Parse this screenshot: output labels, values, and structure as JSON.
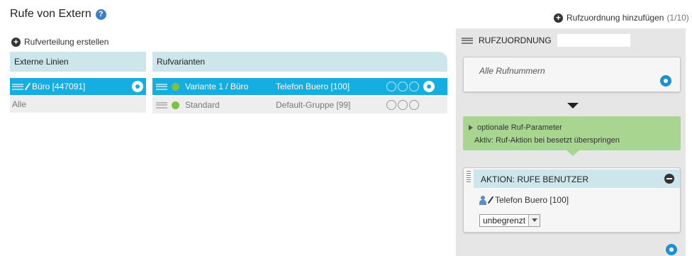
{
  "page": {
    "title": "Rufe von Extern",
    "help_icon": "?"
  },
  "add_assignment": {
    "label": "Rufzuordnung hinzufügen",
    "counter": "(1/10)"
  },
  "create_distribution": {
    "label": "Rufverteilung erstellen"
  },
  "external_lines": {
    "header": "Externe Linien",
    "rows": [
      {
        "label": "Büro [447091]",
        "active": true
      },
      {
        "label": "Alle",
        "active": false
      }
    ]
  },
  "call_variants": {
    "header": "Rufvarianten",
    "rows": [
      {
        "name": "Variante 1 / Büro",
        "target": "Telefon Buero [100]",
        "active": true
      },
      {
        "name": "Standard",
        "target": "Default-Gruppe [99]",
        "active": false
      }
    ]
  },
  "assignment_panel": {
    "title": "RUFZUORDNUNG",
    "name_value": "",
    "numbers_label": "Alle Rufnummern",
    "optional_params": {
      "toggle_label": "optionale Ruf-Parameter",
      "active_text": "Aktiv: Ruf-Aktion bei besetzt überspringen"
    },
    "action": {
      "title": "AKTION: RUFE BENUTZER",
      "user_label": "Telefon Buero [100]",
      "duration_selected": "unbegrenzt"
    }
  },
  "colors": {
    "active_row": "#16aee0",
    "header_bg": "#cde6ec",
    "optional_green": "#a8d590",
    "status_green": "#7cc242"
  }
}
